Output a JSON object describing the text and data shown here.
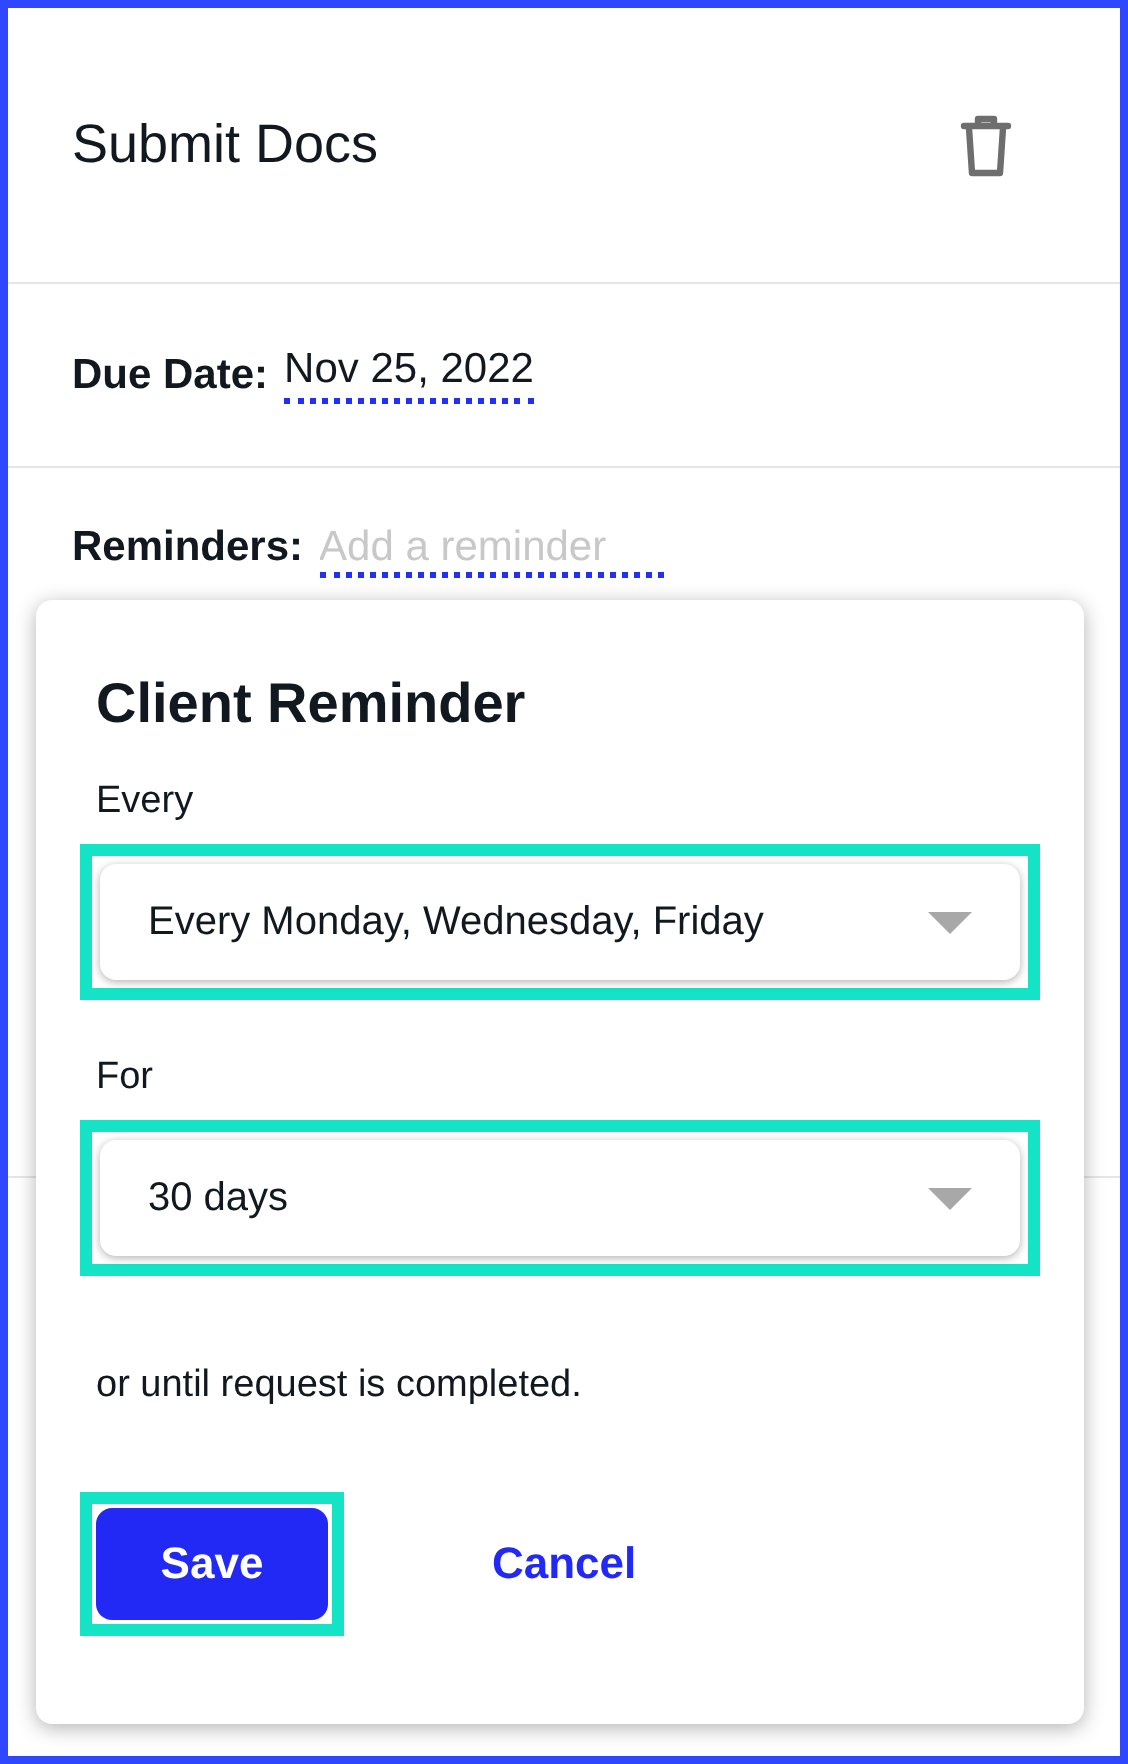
{
  "task": {
    "title": "Submit Docs"
  },
  "fields": [
    {
      "label": "Due Date:",
      "value": "Nov 25, 2022"
    },
    {
      "label": "Reminders:",
      "placeholder": "Add a reminder"
    }
  ],
  "dialog": {
    "title": "Client Reminder",
    "selects": [
      {
        "label": "Every",
        "value": "Every Monday, Wednesday, Friday",
        "highlighted": true
      },
      {
        "label": "For",
        "value": "30 days",
        "highlighted": true
      }
    ],
    "note": "or until request is completed.",
    "buttons": [
      {
        "label": "Save",
        "kind": "primary",
        "highlighted": true
      },
      {
        "label": "Cancel",
        "kind": "link",
        "highlighted": false
      }
    ]
  }
}
